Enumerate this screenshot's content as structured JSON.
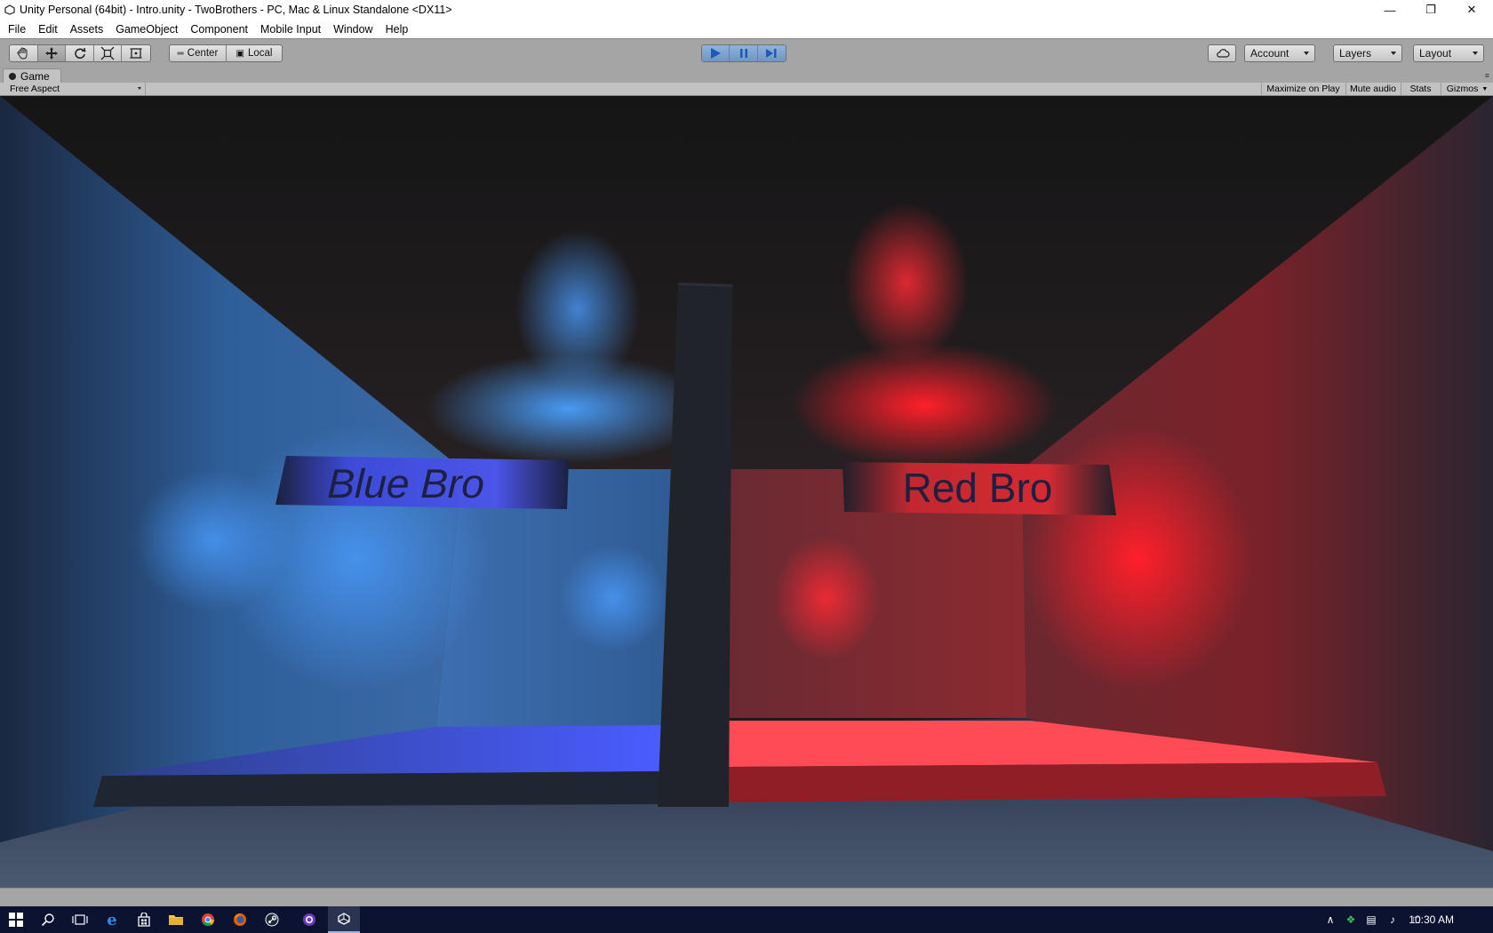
{
  "window": {
    "title": "Unity Personal (64bit) - Intro.unity - TwoBrothers - PC, Mac & Linux Standalone <DX11>"
  },
  "menu": [
    "File",
    "Edit",
    "Assets",
    "GameObject",
    "Component",
    "Mobile Input",
    "Window",
    "Help"
  ],
  "toolbar": {
    "tools": [
      "hand-tool",
      "move-tool",
      "rotate-tool",
      "scale-tool",
      "rect-tool"
    ],
    "active_tool": "move-tool",
    "pivot_label": "Center",
    "space_label": "Local",
    "play_state": "playing",
    "account_label": "Account",
    "layers_label": "Layers",
    "layout_label": "Layout"
  },
  "game_panel": {
    "tab_label": "Game",
    "aspect_label": "Free Aspect",
    "options": [
      "Maximize on Play",
      "Mute audio",
      "Stats",
      "Gizmos"
    ]
  },
  "scene": {
    "left_sign": "Blue Bro",
    "right_sign": "Red Bro",
    "colors": {
      "blue_light": "#3a8cff",
      "red_light": "#ff1f2a",
      "divider": "#20232a"
    }
  },
  "taskbar": {
    "apps": [
      "start-icon",
      "search-icon",
      "task-view-icon",
      "edge-icon",
      "store-icon",
      "file-explorer-icon",
      "chrome-icon",
      "firefox-icon",
      "steam-icon",
      "app-icon",
      "unity-icon"
    ],
    "clock": "10:30 AM"
  }
}
